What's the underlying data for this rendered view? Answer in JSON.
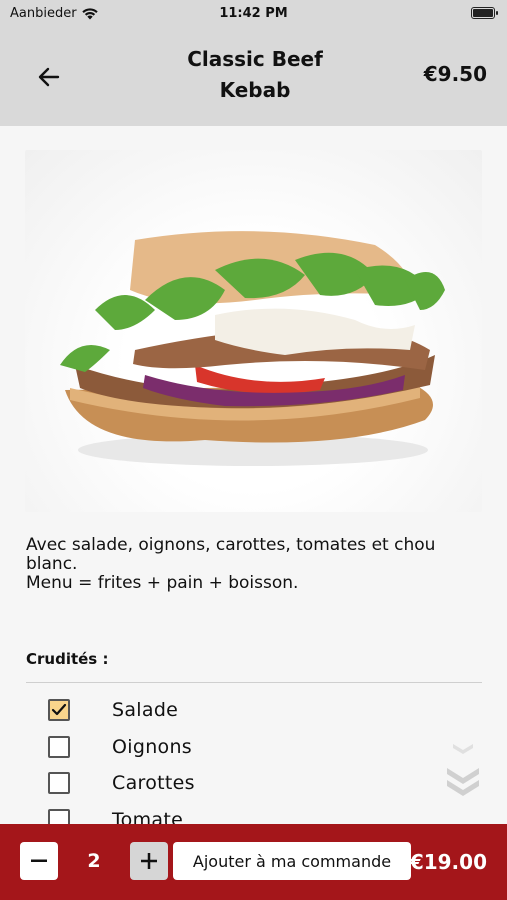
{
  "status_bar": {
    "carrier": "Aanbieder",
    "time": "11:42 PM"
  },
  "header": {
    "title": "Classic Beef Kebab",
    "price": "€9.50",
    "back_icon": "arrow-left-icon"
  },
  "product": {
    "image": "kebab-sandwich-photo",
    "description_line1": "Avec salade, oignons, carottes, tomates et chou blanc.",
    "description_line2": "Menu = frites + pain + boisson."
  },
  "crudites": {
    "label": "Crudités :",
    "options": [
      {
        "label": "Salade",
        "checked": true
      },
      {
        "label": "Oignons",
        "checked": false
      },
      {
        "label": "Carottes",
        "checked": false
      },
      {
        "label": "Tomate",
        "checked": false
      }
    ]
  },
  "order_bar": {
    "quantity": "2",
    "add_label": "Ajouter à ma commande",
    "total": "€19.00",
    "accent_color": "#a4161a"
  }
}
